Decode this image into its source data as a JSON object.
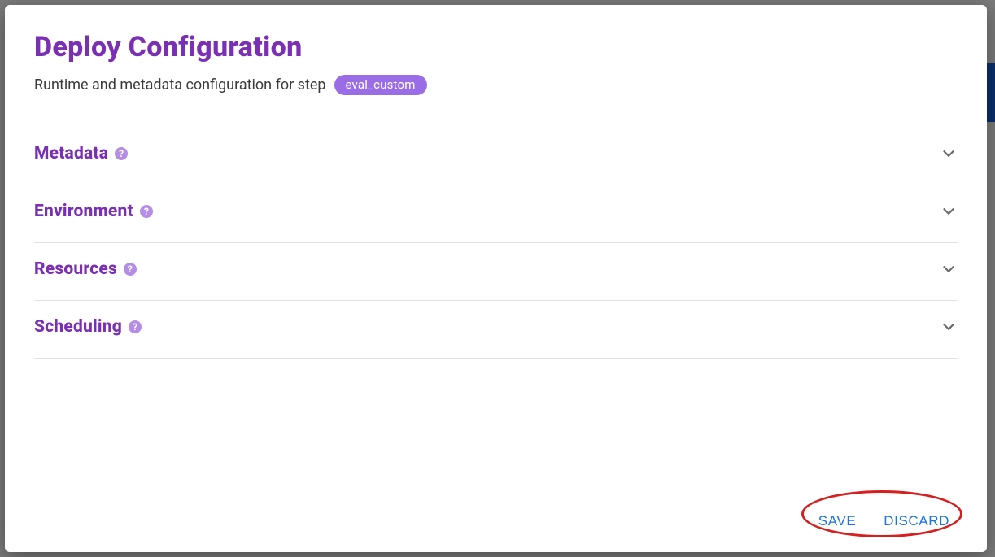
{
  "dialog": {
    "title": "Deploy Configuration",
    "subtitle": "Runtime and metadata configuration for step",
    "step_chip": "eval_custom"
  },
  "sections": [
    {
      "title": "Metadata"
    },
    {
      "title": "Environment"
    },
    {
      "title": "Resources"
    },
    {
      "title": "Scheduling"
    }
  ],
  "footer": {
    "save_label": "SAVE",
    "discard_label": "DISCARD"
  },
  "icons": {
    "help_glyph": "?"
  }
}
